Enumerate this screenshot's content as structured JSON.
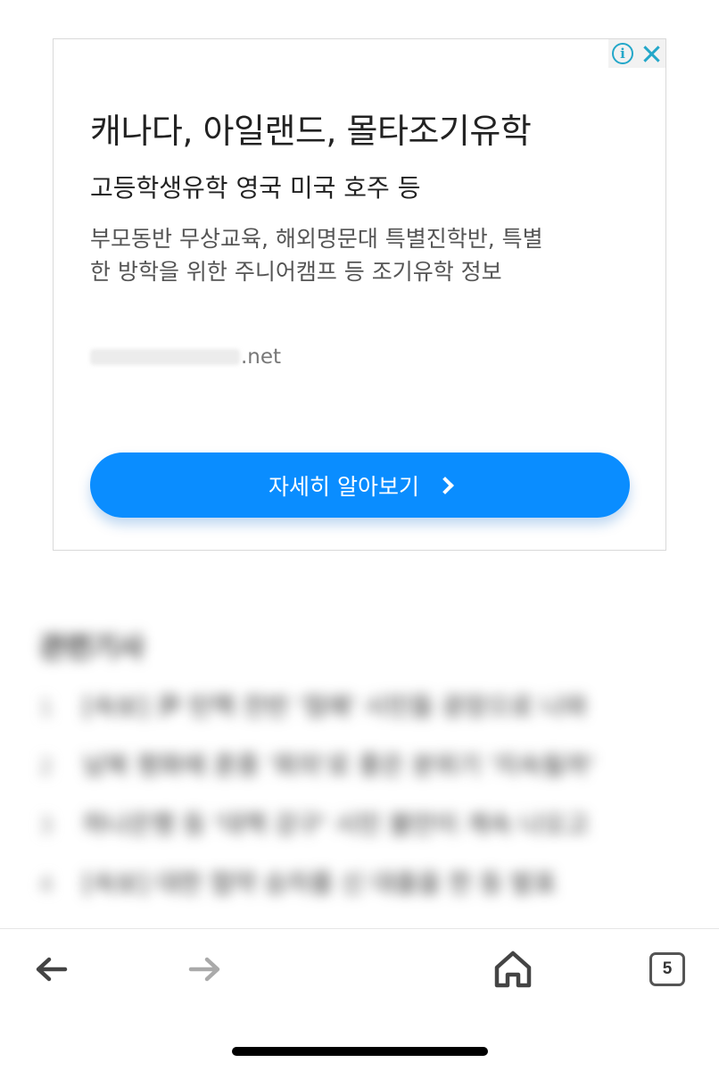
{
  "ad": {
    "title": "캐나다, 아일랜드, 몰타조기유학",
    "subtitle": "고등학생유학 영국 미국 호주 등",
    "description": "부모동반 무상교육, 해외명문대 특별진학반, 특별한 방학을 위한 주니어캠프 등 조기유학 정보",
    "url_suffix": ".net",
    "info_icon_glyph": "i",
    "cta_label": "자세히 알아보기"
  },
  "related": {
    "title": "관련기사",
    "items": [
      {
        "num": "1",
        "text": "[속보] 尹 탄핵 찬반 '첨예' 시민들 광장으로 나와"
      },
      {
        "num": "2",
        "text": "남북 평화에 훈풍 '회의'로 좋은 분위기 '지속될까'"
      },
      {
        "num": "3",
        "text": "하나은행 등 '대책 강구' 시민 불만이 계속 나오고"
      },
      {
        "num": "4",
        "text": "[속보] 대한 협약 승차를 신 대출을 한 등 발표"
      }
    ]
  },
  "toolbar": {
    "tab_count": "5"
  },
  "colors": {
    "accent": "#0a8dff",
    "adchoices": "#23a7c9"
  }
}
